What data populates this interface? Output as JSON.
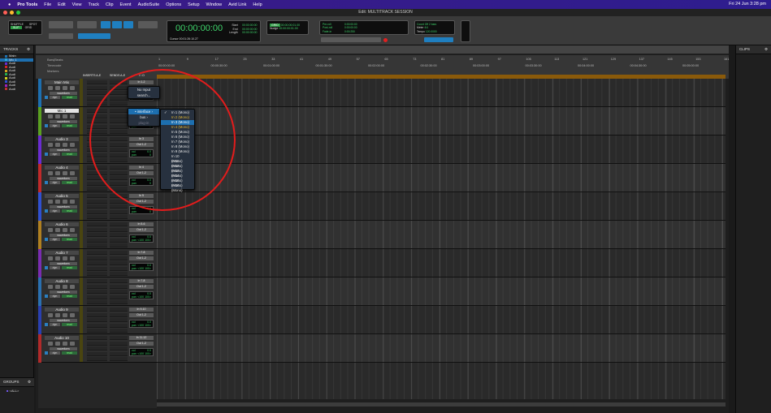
{
  "menubar": {
    "app": "Pro Tools",
    "items": [
      "File",
      "Edit",
      "View",
      "Track",
      "Clip",
      "Event",
      "AudioSuite",
      "Options",
      "Setup",
      "Window",
      "Avid Link",
      "Help"
    ],
    "clock": "Fri 24 Jun 3:28 pm"
  },
  "window": {
    "title": "Edit: MULTITRACK SESSION"
  },
  "toolbar": {
    "modes": [
      "SHUFFLE",
      "SPOT",
      "SLIP",
      "GRID"
    ],
    "main_counter": "00:00:00:00",
    "start": "00:00:00:00",
    "end": "00:00:00:00",
    "length": "00:00:00:00",
    "start_label": "Start",
    "end_label": "End",
    "length_label": "Length",
    "cursor_label": "Cursor",
    "cursor_value": "00:01:26:10.27",
    "nudge_label": "Nudge",
    "grid_value": "00:00:00:01.00",
    "nudge_value": "00:00:00:01.00",
    "preroll_label": "Pre-roll",
    "postroll_label": "Post-roll",
    "fade_label": "Fade-in",
    "preroll": "0:00:00:00",
    "postroll": "0:00:00:00",
    "fadein": "0:00:250",
    "meter_label": "Meter",
    "meter_value": "4/4",
    "tempo_label": "Tempo",
    "tempo_value": "120.0000",
    "count_off": "Count Off",
    "bars": "2 bars"
  },
  "tracks_panel": {
    "title": "TRACKS",
    "items": [
      {
        "name": "Main",
        "color": "#1d6fb0"
      },
      {
        "name": "Mic 1",
        "color": "#2fa7d8"
      },
      {
        "name": "Audi",
        "color": "#6a2cd0"
      },
      {
        "name": "Audi",
        "color": "#d02525"
      },
      {
        "name": "Audi",
        "color": "#d0a020"
      },
      {
        "name": "Audi",
        "color": "#25b050"
      },
      {
        "name": "Audi",
        "color": "#d0d020"
      },
      {
        "name": "Audi",
        "color": "#3050d0"
      },
      {
        "name": "Audi",
        "color": "#a020c0"
      },
      {
        "name": "Audi",
        "color": "#c03030"
      }
    ]
  },
  "groups_panel": {
    "title": "GROUPS",
    "item": "<ALL>"
  },
  "clips_panel": {
    "title": "CLIPS"
  },
  "ruler": {
    "labels": [
      "Bars|Beats",
      "Timecode",
      "Markers"
    ],
    "bars": [
      "1",
      "9",
      "17",
      "25",
      "33",
      "41",
      "49",
      "57",
      "65",
      "73",
      "81",
      "89",
      "97",
      "105",
      "113",
      "121",
      "129",
      "137",
      "145",
      "153",
      "161"
    ],
    "timecodes": [
      "00:00:00:00",
      "00:00:30:00",
      "00:01:00:00",
      "00:01:30:00",
      "00:02:00:00",
      "00:02:30:00",
      "00:03:00:00",
      "00:03:30:00",
      "00:04:00:00",
      "00:04:30:00",
      "00:05:00:00"
    ]
  },
  "columns": {
    "inserts": "INSERTS A-E",
    "sends": "SENDS A-E",
    "io": "I / O"
  },
  "tracks": [
    {
      "name": "Main Mix",
      "color": "#1d6fb0",
      "input": "In 1-2",
      "output": "Out 1-2",
      "vol": "0.0",
      "pan": "<100  100>",
      "meter_color": "#3d3a10"
    },
    {
      "name": "Mic 1",
      "color": "#5aa020",
      "input": "In 1",
      "output": "Out 1-2",
      "vol": "0.0",
      "pan": "0",
      "selected": true
    },
    {
      "name": "Audio 3",
      "color": "#6a2cd0",
      "input": "In 3",
      "output": "Out 1-2",
      "vol": "0.0",
      "pan": "0"
    },
    {
      "name": "Audio 4",
      "color": "#c02a2a",
      "input": "In 4",
      "output": "Out 1-2",
      "vol": "0.0",
      "pan": "0"
    },
    {
      "name": "Audio 5",
      "color": "#3050d0",
      "input": "In 5",
      "output": "Out 1-2",
      "vol": "0.0",
      "pan": "0"
    },
    {
      "name": "Audio 6",
      "color": "#b08020",
      "input": "In 5-6",
      "output": "Out 1-2",
      "vol": "0.0",
      "pan": "<100  100>"
    },
    {
      "name": "Audio 7",
      "color": "#7a2cb0",
      "input": "In 7-8",
      "output": "Out 1-2",
      "vol": "0.0",
      "pan": "<100  100>"
    },
    {
      "name": "Audio 8",
      "color": "#2a70b0",
      "input": "In 7-8",
      "output": "Out 1-2",
      "vol": "0.0",
      "pan": "<100  100>"
    },
    {
      "name": "Audio 9",
      "color": "#2a40b0",
      "input": "In 9-10",
      "output": "Out 1-2",
      "vol": "0.0",
      "pan": "<100  100>"
    },
    {
      "name": "Audio 10",
      "color": "#b02a2a",
      "input": "In 11-12",
      "output": "Out 1-2",
      "vol": "0.0",
      "pan": "<100  100>"
    }
  ],
  "track_labels": {
    "mode": "waveform",
    "dyn": "dyn",
    "read": "read",
    "vol": "vol",
    "pan": "pan"
  },
  "input_menu": {
    "top": [
      "No Input",
      "search..."
    ],
    "categories": [
      "interface",
      "bus",
      "plug-in"
    ],
    "submenu": [
      "In 1 (Mono)",
      "In 2 (Mono)",
      "In 3 (Mono)",
      "In 4 (Mono)",
      "In 5 (Mono)",
      "In 6 (Mono)",
      "In 7 (Mono)",
      "In 8 (Mono)",
      "In 9 (Mono)",
      "In 10 (Mono)",
      "In 11 (Mono)",
      "In 12 (Mono)",
      "In 13 (Mono)",
      "In 14 (Mono)",
      "In 15 (Mono)",
      "In 16 (Mono)"
    ],
    "checked": 0,
    "highlighted": 2,
    "in_use": [
      1,
      3
    ]
  },
  "colors": {
    "menubar": "#3b1a86",
    "accent": "#1d6fb0",
    "annotation": "#e21c1c",
    "counter": "#3fd36b"
  }
}
